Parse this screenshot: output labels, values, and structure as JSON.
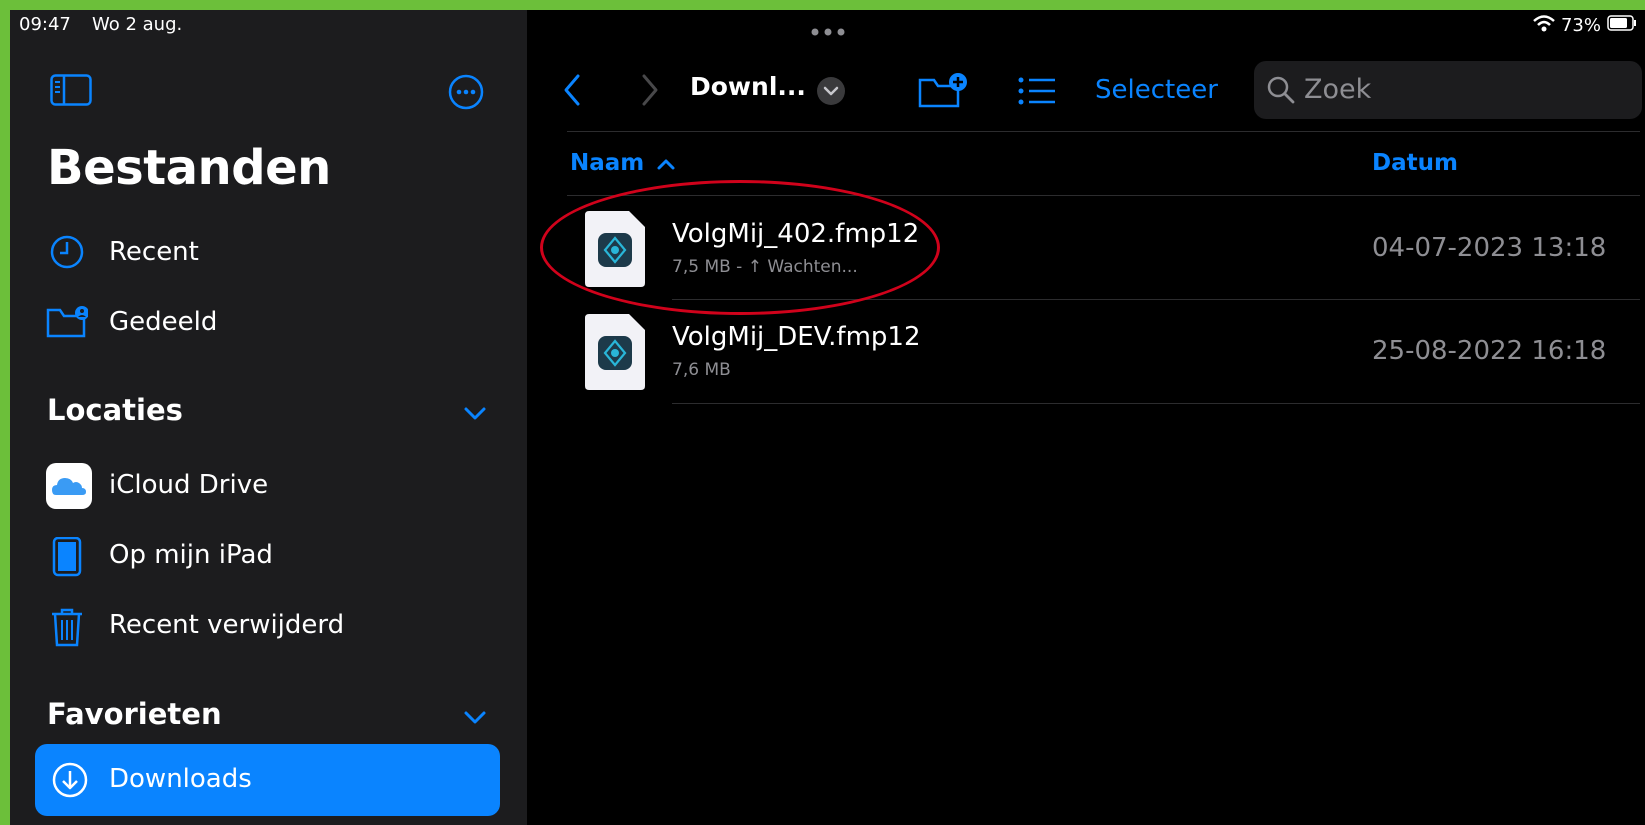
{
  "status_bar": {
    "time": "09:47",
    "date": "Wo 2 aug.",
    "battery": "73%"
  },
  "sidebar": {
    "title": "Bestanden",
    "items": [
      {
        "label": "Recent",
        "icon": "clock-icon"
      },
      {
        "label": "Gedeeld",
        "icon": "shared-folder-icon"
      }
    ],
    "locations": {
      "header": "Locaties",
      "items": [
        {
          "label": "iCloud Drive",
          "icon": "icloud-icon"
        },
        {
          "label": "Op mijn iPad",
          "icon": "ipad-icon"
        },
        {
          "label": "Recent verwijderd",
          "icon": "trash-icon"
        }
      ]
    },
    "favorites": {
      "header": "Favorieten",
      "items": [
        {
          "label": "Downloads",
          "icon": "download-icon",
          "active": true
        }
      ]
    }
  },
  "toolbar": {
    "breadcrumb": "Downl...",
    "select_label": "Selecteer",
    "search_placeholder": "Zoek"
  },
  "table": {
    "columns": {
      "name": "Naam",
      "date": "Datum"
    },
    "files": [
      {
        "name": "VolgMij_402.fmp12",
        "meta": "7,5 MB - ↑ Wachten...",
        "date": "04-07-2023 13:18"
      },
      {
        "name": "VolgMij_DEV.fmp12",
        "meta": "7,6 MB",
        "date": "25-08-2022 16:18"
      }
    ]
  },
  "colors": {
    "accent": "#0a84ff",
    "sidebar_bg": "#1c1c1e",
    "main_bg": "#000000",
    "frame_border": "#6cbf3a",
    "annotation": "#d0021b"
  }
}
